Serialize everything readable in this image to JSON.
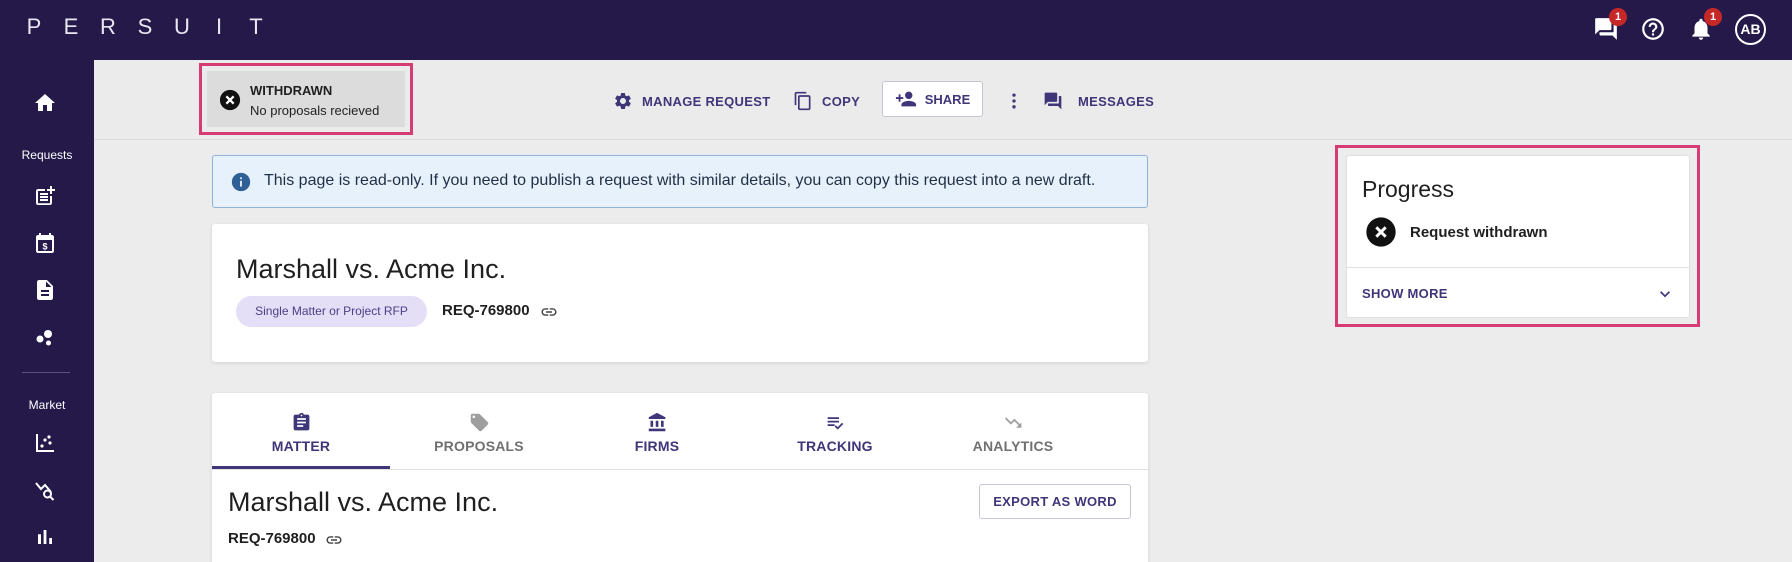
{
  "app": {
    "logo_letters": [
      "P",
      "E",
      "R",
      "S",
      "U",
      "I",
      "T"
    ]
  },
  "topbar": {
    "messages_badge": "1",
    "notifications_badge": "1",
    "avatar_initials": "AB"
  },
  "sidebar": {
    "requests_label": "Requests",
    "market_label": "Market"
  },
  "status": {
    "title": "WITHDRAWN",
    "subtitle": "No proposals recieved"
  },
  "actions": {
    "manage": "MANAGE REQUEST",
    "copy": "COPY",
    "share": "SHARE",
    "messages": "MESSAGES"
  },
  "banner": {
    "text": "This page is read-only. If you need to publish a request with similar details, you can copy this request into a new draft."
  },
  "request": {
    "title": "Marshall vs. Acme Inc.",
    "type_chip": "Single Matter or Project RFP",
    "id": "REQ-769800"
  },
  "tabs": [
    {
      "label": "MATTER"
    },
    {
      "label": "PROPOSALS"
    },
    {
      "label": "FIRMS"
    },
    {
      "label": "TRACKING"
    },
    {
      "label": "ANALYTICS"
    }
  ],
  "matter": {
    "title": "Marshall vs. Acme Inc.",
    "id": "REQ-769800",
    "export_label": "EXPORT AS WORD"
  },
  "progress": {
    "title": "Progress",
    "status": "Request withdrawn",
    "show_more": "SHOW MORE"
  },
  "colors": {
    "nav_bg": "#25194a",
    "accent": "#3f3679",
    "highlight": "#d63b73",
    "chip_bg": "#e5def7",
    "banner_bg": "#e7f1fb"
  }
}
